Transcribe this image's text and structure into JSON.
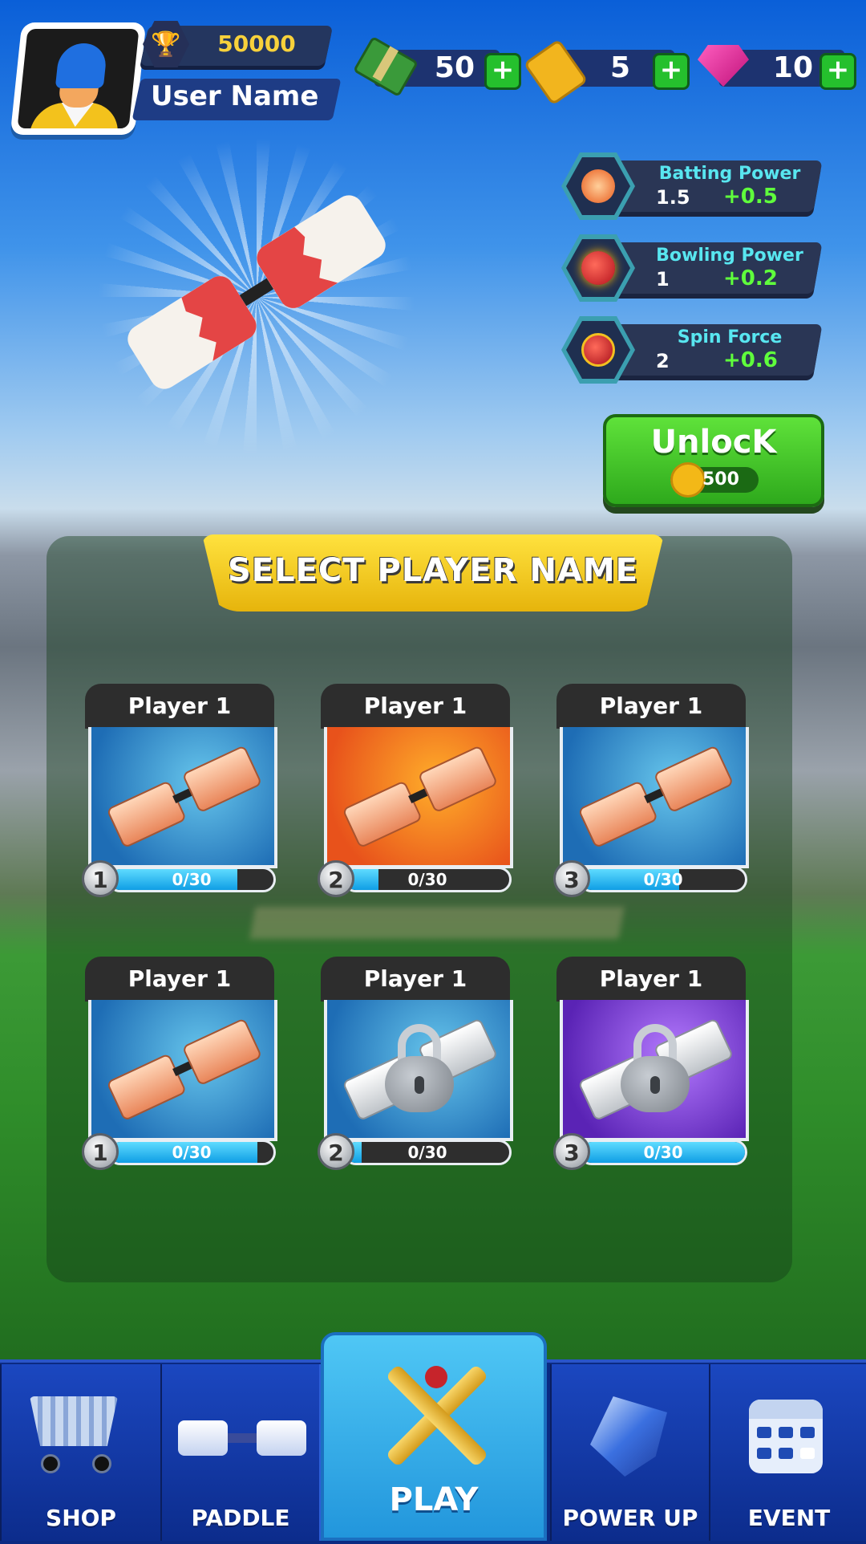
{
  "header": {
    "trophy_count": "50000",
    "user_name": "User Name"
  },
  "currencies": [
    {
      "icon": "cash-icon",
      "value": "50",
      "add_label": "+"
    },
    {
      "icon": "ticket-icon",
      "value": "5",
      "add_label": "+"
    },
    {
      "icon": "gem-icon",
      "value": "10",
      "add_label": "+"
    }
  ],
  "stats": [
    {
      "icon": "bat-swing-icon",
      "label": "Batting Power",
      "value": "1.5",
      "bonus": "+0.5"
    },
    {
      "icon": "fire-ball-icon",
      "label": "Bowling Power",
      "value": "1",
      "bonus": "+0.2"
    },
    {
      "icon": "spin-ball-icon",
      "label": "Spin Force",
      "value": "2",
      "bonus": "+0.6"
    }
  ],
  "unlock": {
    "label": "UnlocK",
    "cost": "500"
  },
  "select_title": "SELECT PLAYER NAME",
  "players": [
    {
      "name": "Player 1",
      "level": "1",
      "progress_text": "0/30",
      "progress": 0.78,
      "theme": "blue",
      "locked": false
    },
    {
      "name": "Player 1",
      "level": "2",
      "progress_text": "0/30",
      "progress": 0.2,
      "theme": "orange",
      "locked": false
    },
    {
      "name": "Player 1",
      "level": "3",
      "progress_text": "0/30",
      "progress": 0.6,
      "theme": "blue",
      "locked": false
    },
    {
      "name": "Player 1",
      "level": "1",
      "progress_text": "0/30",
      "progress": 0.9,
      "theme": "blue",
      "locked": false
    },
    {
      "name": "Player 1",
      "level": "2",
      "progress_text": "0/30",
      "progress": 0.1,
      "theme": "blue",
      "locked": true
    },
    {
      "name": "Player 1",
      "level": "3",
      "progress_text": "0/30",
      "progress": 1.0,
      "theme": "purple",
      "locked": true
    }
  ],
  "nav": {
    "shop": "SHOP",
    "paddle": "PADDLE",
    "play": "PLAY",
    "power_up": "POWER UP",
    "event": "EVENT"
  },
  "colors": {
    "accent_green": "#2ea91c",
    "banner_yellow": "#f4cc1c",
    "nav_blue": "#0c2c8c",
    "play_cyan": "#2296dc",
    "stat_label": "#58e6f0",
    "stat_bonus": "#5fff3c"
  }
}
